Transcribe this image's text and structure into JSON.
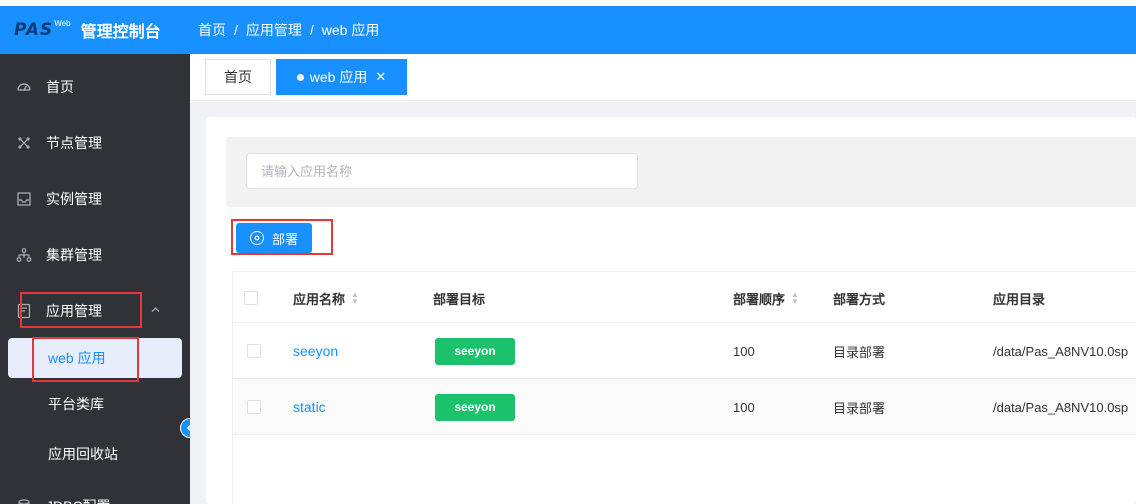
{
  "header": {
    "logo_text": "PAS",
    "logo_sup": "Web",
    "title": "管理控制台",
    "breadcrumb": [
      "首页",
      "应用管理",
      "web 应用"
    ],
    "breadcrumb_sep": "/",
    "bg_color": "#1890ff"
  },
  "sidebar": {
    "bg_color": "#2f3337",
    "items": [
      {
        "label": "首页",
        "icon": "dashboard-icon"
      },
      {
        "label": "节点管理",
        "icon": "nodes-icon"
      },
      {
        "label": "实例管理",
        "icon": "inbox-icon"
      },
      {
        "label": "集群管理",
        "icon": "cluster-icon"
      },
      {
        "label": "应用管理",
        "icon": "app-icon"
      }
    ],
    "sub_items": [
      {
        "label": "web 应用",
        "active": true
      },
      {
        "label": "平台类库",
        "active": false
      },
      {
        "label": "应用回收站",
        "active": false
      }
    ],
    "partial_item": "JDBC配置"
  },
  "tabs": [
    {
      "label": "首页",
      "active": false
    },
    {
      "label": "web 应用",
      "active": true
    }
  ],
  "search": {
    "placeholder": "请输入应用名称",
    "value": ""
  },
  "toolbar": {
    "deploy_label": "部署",
    "deploy_icon": "gear-icon"
  },
  "table": {
    "columns": [
      "应用名称",
      "部署目标",
      "部署顺序",
      "部署方式",
      "应用目录"
    ],
    "rows": [
      {
        "name": "seeyon",
        "target": "seeyon",
        "order": "100",
        "method": "目录部署",
        "dir": "/data/Pas_A8NV10.0sp"
      },
      {
        "name": "static",
        "target": "seeyon",
        "order": "100",
        "method": "目录部署",
        "dir": "/data/Pas_A8NV10.0sp"
      }
    ]
  },
  "colors": {
    "accent": "#1890ff",
    "tag_green": "#19c26b",
    "highlight_red": "#e53935"
  }
}
